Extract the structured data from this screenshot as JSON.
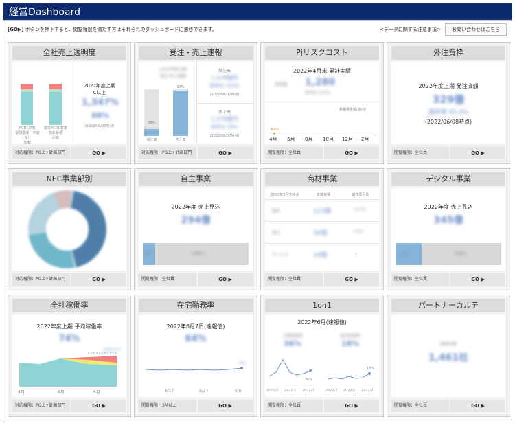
{
  "header": {
    "title": "経営Dashboard"
  },
  "info": {
    "go_tag": "[GO▶]",
    "description": "ボタンを押下すると、閲覧権限を満たす方はそれぞれのダッシュボードに遷移できます。",
    "notice_link": "<データに関する注意事項>",
    "contact_button": "お問い合わせはこちら"
  },
  "colors": {
    "header_bg": "#0c2a6e",
    "accent_blue": "#6d8ec8",
    "chart_blue": "#86b3d8",
    "teal": "#8fd4d4",
    "red": "#f08080",
    "yellow": "#f2e870"
  },
  "cards": {
    "c1": {
      "title": "全社売上透明度",
      "bar1_label1": "PCDC対象",
      "bar1_label2": "受領関係（不良含）",
      "bar1_label3": "比較",
      "bar2_label1": "前年PCDC対象",
      "bar2_label2": "前年受領",
      "bar2_label3": "比較",
      "period": "2022年度上期",
      "sub": "C以上",
      "value": "1,347%",
      "value2": "98%",
      "date": "(2022/06/07時点)",
      "foot": "対応権限：PG上+計画部門",
      "go": "GO ▶"
    },
    "c2": {
      "title": "受注・売上速報",
      "bar1_label": "受注高",
      "bar2_label": "売上高",
      "bar1_pct": "15%",
      "bar2_pct": "97%",
      "r1_title": "受注高",
      "r1_v1": "1,078億円",
      "r1_v2": "前年比 103%",
      "r1_date": "(2022/06/07時点)",
      "r2_title": "売上高",
      "r2_v1": "1,078億円",
      "r2_v2": "前年比 99%",
      "r2_date": "(2022/06/07時点)",
      "bl1": "2022年度上期",
      "bl2": "受注 売上速報",
      "foot": "対応権限：PG上+計画部門",
      "go": "GO ▶"
    },
    "c3": {
      "title": "Pjリスクコスト",
      "heading": "2022年4月末 累計実績",
      "v_label": "発生額",
      "v_value": "1,280",
      "v_sub": "前年比 103%",
      "legend": "累積発生額(億円)",
      "peak": "9.4%",
      "x_ticks": [
        "4月",
        "6月",
        "8月",
        "10月",
        "12月",
        "2月"
      ],
      "foot": "閲覧権限：全社員",
      "go": "GO ▶"
    },
    "c4": {
      "title": "外注費枠",
      "heading": "2022年度上期 発注済額",
      "value1": "329億",
      "value2": "進捗率 95.4%",
      "date": "(2022/06/08時点)",
      "foot": "閲覧権限：全社員",
      "go": "GO ▶"
    },
    "c5": {
      "title": "NEC事業部別",
      "foot": "対応権限：PG上+計画部門",
      "go": "GO ▶"
    },
    "c6": {
      "title": "自主事業",
      "heading": "2022年度 売上見込",
      "value": "294億",
      "bar_left": "上期",
      "bar_right": "下期見込",
      "foot": "閲覧権限：全社員",
      "go": "GO ▶"
    },
    "c7": {
      "title": "商材事業",
      "col1": "2022年3月末時点",
      "col2": "年度実績",
      "col3": "前年同月比",
      "rows": [
        {
          "name": "販売",
          "v": "123億",
          "r": "+17%"
        },
        {
          "name": "保守",
          "v": "56億",
          "r": "+5%"
        },
        {
          "name": "サービス",
          "v": "18億",
          "r": "-"
        }
      ],
      "foot": "閲覧権限：全社員",
      "go": "GO ▶"
    },
    "c8": {
      "title": "デジタル事業",
      "heading": "2022年度 売上見込",
      "value": "345億",
      "bar_left": "上期",
      "bar_right": "下期見込",
      "foot": "閲覧権限：全社員",
      "go": "GO ▶"
    },
    "c9": {
      "title": "全社稼働率",
      "heading": "2022年度上期 平均稼働率",
      "value": "74%",
      "line_label": "目標値 85%",
      "x_ticks": [
        "4月",
        "6月",
        "8月"
      ],
      "foot": "対応権限：PG上+計画部門",
      "go": "GO ▶"
    },
    "c10": {
      "title": "在宅勤務率",
      "heading": "2022年6月7日(速報値)",
      "value": "64%",
      "end_label": "64%",
      "x_ticks": [
        "6/17",
        "5/27",
        "6/6"
      ],
      "foot": "閲覧権限：SM以上",
      "go": "GO ▶"
    },
    "c11": {
      "title": "1on1",
      "heading": "2022年6月(速報値)",
      "l_label": "上期実施率",
      "l_value": "36%",
      "r_label": "前月実施率",
      "r_value": "18%",
      "l_end": "36%",
      "r_end": "18%",
      "l_ticks": [
        "2021/7",
        "2022/1",
        "2022/7"
      ],
      "r_ticks": [
        "2021/7",
        "2022/1",
        "2022/7"
      ],
      "foot": "閲覧権限：全社員",
      "go": "GO ▶"
    },
    "c12": {
      "title": "パートナーカルテ",
      "label": "登録社数",
      "value": "1,461社",
      "foot": "閲覧権限：全社員",
      "go": "GO ▶"
    }
  }
}
